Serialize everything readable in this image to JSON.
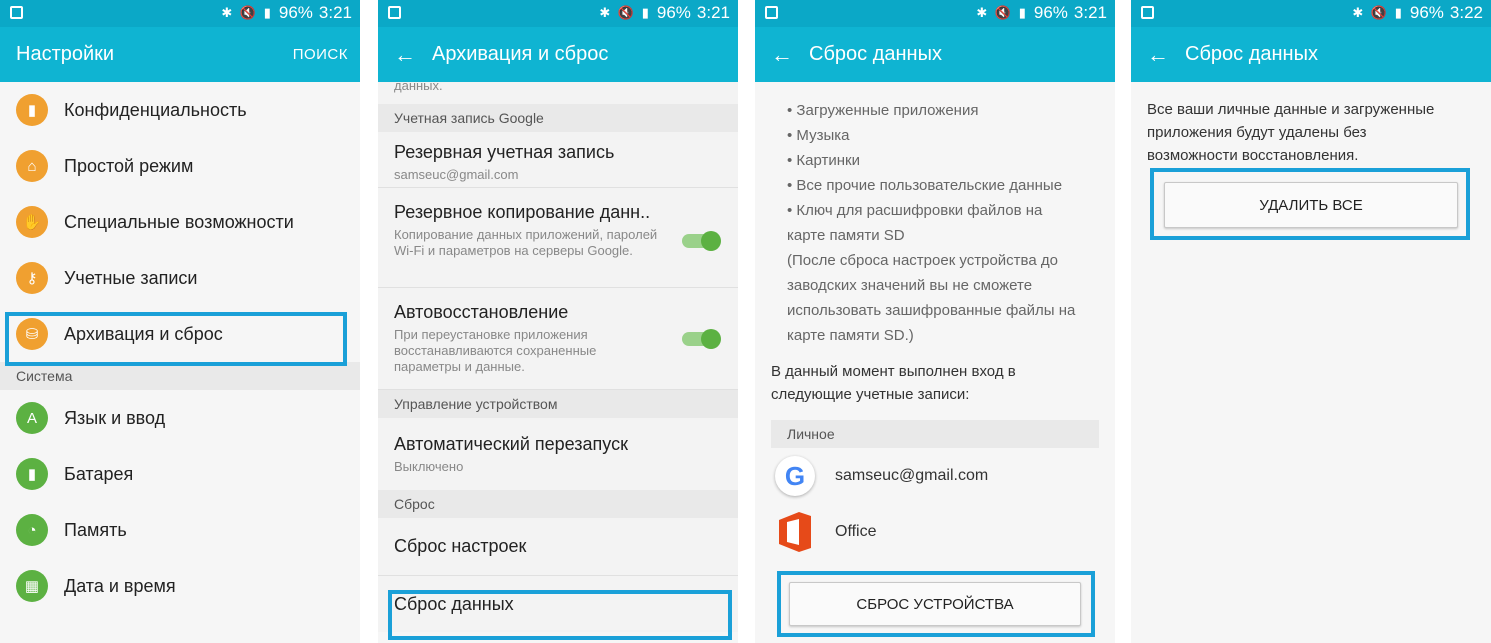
{
  "status": {
    "percent": "96%",
    "time1": "3:21",
    "time2": "3:21",
    "time3": "3:21",
    "time4": "3:22",
    "icons": "✱ 🔇 ▮"
  },
  "panel1": {
    "title": "Настройки",
    "search": "ПОИСК",
    "items_top": [
      {
        "label": "Конфиденциальность",
        "icon": "privacy-icon",
        "glyph": "▮"
      },
      {
        "label": "Простой режим",
        "icon": "home-icon",
        "glyph": "⌂"
      },
      {
        "label": "Специальные возможности",
        "icon": "hand-icon",
        "glyph": "✋"
      },
      {
        "label": "Учетные записи",
        "icon": "key-icon",
        "glyph": "⚷"
      },
      {
        "label": "Архивация и сброс",
        "icon": "backup-icon",
        "glyph": "⛁"
      }
    ],
    "section": "Система",
    "items_bottom": [
      {
        "label": "Язык и ввод",
        "icon": "language-icon",
        "glyph": "A"
      },
      {
        "label": "Батарея",
        "icon": "battery-icon",
        "glyph": "▮"
      },
      {
        "label": "Память",
        "icon": "memory-icon",
        "glyph": "◔"
      },
      {
        "label": "Дата и время",
        "icon": "calendar-icon",
        "glyph": "▦"
      }
    ]
  },
  "panel2": {
    "title": "Архивация и сброс",
    "top_cut": "данных.",
    "section_google": "Учетная запись Google",
    "backup_account_title": "Резервная учетная запись",
    "backup_account_sub": "samseuc@gmail.com",
    "backup_data_title": "Резервное копирование данн..",
    "backup_data_sub": "Копирование данных приложений, паролей Wi-Fi и параметров на серверы Google.",
    "autorestore_title": "Автовосстановление",
    "autorestore_sub": "При переустановке приложения восстанавливаются сохраненные параметры и данные.",
    "section_device": "Управление устройством",
    "autorestart_title": "Автоматический перезапуск",
    "autorestart_sub": "Выключено",
    "section_reset": "Сброс",
    "reset_settings": "Сброс настроек",
    "reset_data": "Сброс данных"
  },
  "panel3": {
    "title": "Сброс данных",
    "bullets": [
      "• Загруженные приложения",
      "• Музыка",
      "• Картинки",
      "• Все прочие пользовательские данные",
      "• Ключ для расшифровки файлов на карте памяти SD"
    ],
    "note": "(После сброса настроек устройства до заводских значений вы не сможете использовать зашифрованные файлы на карте памяти SD.)",
    "logged_in": "В данный момент выполнен вход в следующие учетные записи:",
    "personal": "Личное",
    "account_google": "samseuc@gmail.com",
    "account_office": "Office",
    "button": "СБРОС УСТРОЙСТВА"
  },
  "panel4": {
    "title": "Сброс данных",
    "text": "Все ваши личные данные и загруженные приложения будут удалены без возможности восстановления.",
    "button": "УДАЛИТЬ ВСЕ"
  },
  "colors": {
    "appbar": "#0fb4d2",
    "statusbar": "#0ba8c7",
    "highlight": "#1aa0d8",
    "orange": "#f0a030",
    "green": "#5cb142"
  }
}
